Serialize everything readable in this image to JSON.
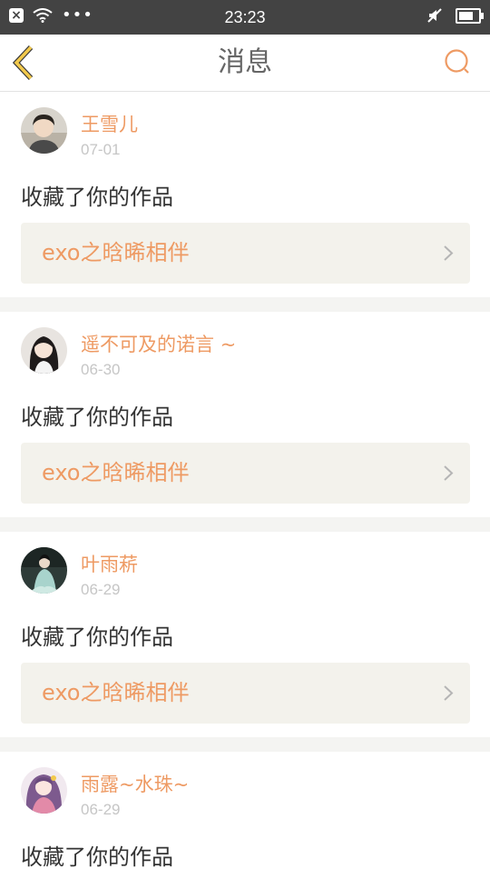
{
  "status_bar": {
    "time": "23:23",
    "icons": [
      "close-notification-icon",
      "wifi-icon",
      "more-dots-icon",
      "mute-icon",
      "battery-icon"
    ]
  },
  "nav": {
    "title": "消息",
    "back_icon": "chevron-left-icon",
    "search_icon": "search-icon"
  },
  "colors": {
    "accent": "#ee9a63",
    "back_arrow": "#f2c94c",
    "status_bar": "#434343",
    "card_bg": "#ffffff",
    "work_bg": "#f3f2ec"
  },
  "messages": [
    {
      "user": "王雪儿",
      "date": "07-01",
      "action": "收藏了你的作品",
      "work": "exo之晗晞相伴"
    },
    {
      "user": "遥不可及的诺言 ~",
      "date": "06-30",
      "action": "收藏了你的作品",
      "work": "exo之晗晞相伴"
    },
    {
      "user": "叶雨菥",
      "date": "06-29",
      "action": "收藏了你的作品",
      "work": "exo之晗晞相伴"
    },
    {
      "user": "雨露~水珠~",
      "date": "06-29",
      "action": "收藏了你的作品",
      "work": ""
    }
  ]
}
